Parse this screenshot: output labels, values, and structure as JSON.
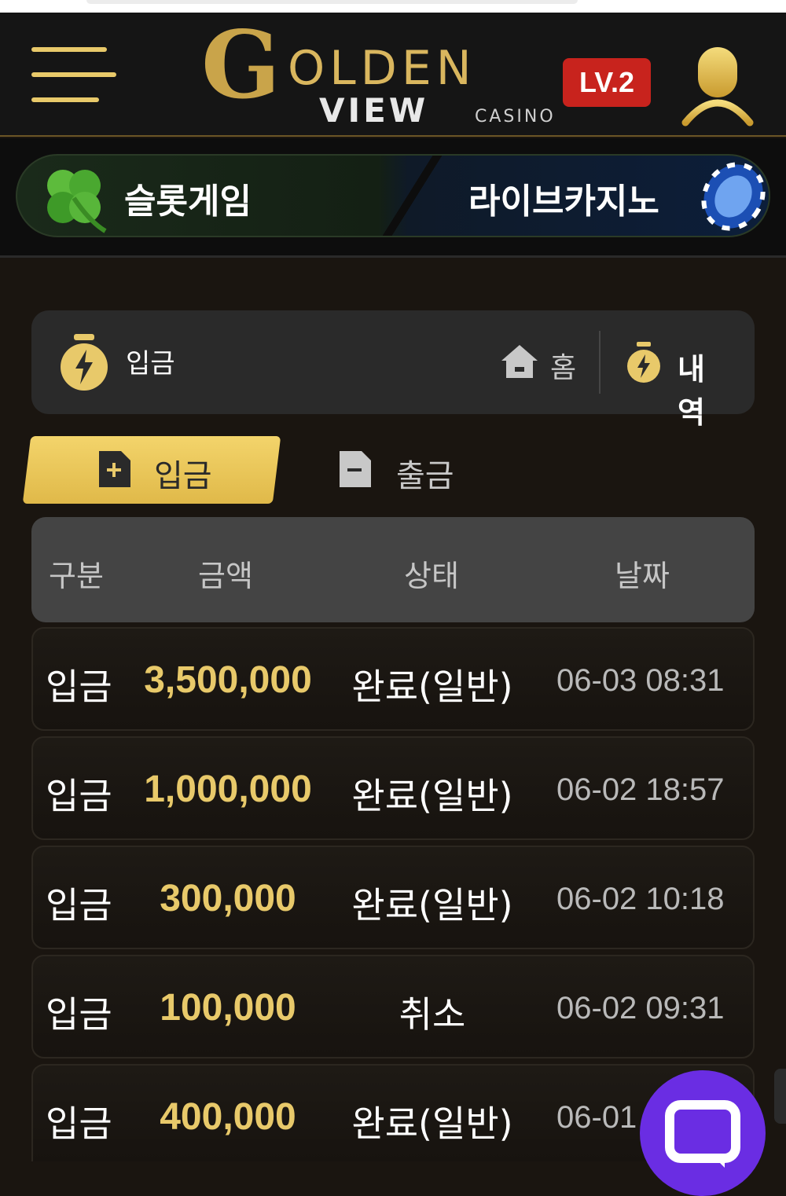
{
  "header": {
    "logo_text_g": "G",
    "logo_text_golden": "OLDEN",
    "logo_text_view": "VIEW",
    "logo_text_casino": "CASINO",
    "level_badge": "LV.2"
  },
  "game_nav": {
    "slot_label": "슬롯게임",
    "live_label": "라이브카지노"
  },
  "breadcrumb": {
    "title": "입금",
    "home_label": "홈",
    "history_label": "내역"
  },
  "tabs": {
    "deposit_label": "입금",
    "withdraw_label": "출금"
  },
  "table": {
    "headers": [
      "구분",
      "금액",
      "상태",
      "날짜"
    ],
    "rows": [
      {
        "type": "입금",
        "amount": "3,500,000",
        "status": "완료(일반)",
        "date": "06-03 08:31"
      },
      {
        "type": "입금",
        "amount": "1,000,000",
        "status": "완료(일반)",
        "date": "06-02 18:57"
      },
      {
        "type": "입금",
        "amount": "300,000",
        "status": "완료(일반)",
        "date": "06-02 10:18"
      },
      {
        "type": "입금",
        "amount": "100,000",
        "status": "취소",
        "date": "06-02 09:31"
      },
      {
        "type": "입금",
        "amount": "400,000",
        "status": "완료(일반)",
        "date": "06-01"
      }
    ]
  },
  "colors": {
    "accent_gold": "#e8c96a",
    "badge_red": "#c8231d",
    "chat_purple": "#6a2de3",
    "panel_bg": "#2a2a2a"
  },
  "icons": {
    "menu": "hamburger-icon",
    "user": "user-icon",
    "slot": "clover-icon",
    "live": "casino-chip-icon",
    "breadcrumb": "stopwatch-bolt-icon",
    "home": "home-icon",
    "history": "stopwatch-bolt-icon",
    "deposit": "plus-document-icon",
    "withdraw": "minus-document-icon",
    "chat": "chat-bubble-icon"
  }
}
